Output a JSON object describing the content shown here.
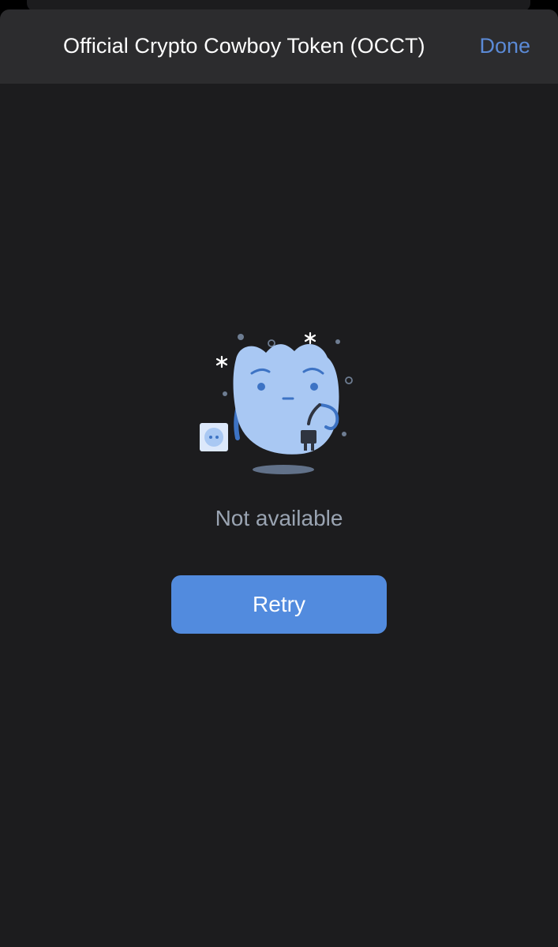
{
  "header": {
    "title": "Official Crypto Cowboy Token (OCCT)",
    "done_label": "Done"
  },
  "main": {
    "status_text": "Not available",
    "retry_label": "Retry",
    "illustration_icon": "unplugged-ghost-icon"
  },
  "colors": {
    "background": "#1c1c1e",
    "nav_background": "#2c2c2e",
    "accent": "#528bde",
    "link": "#5b8ad6",
    "status_text": "#9aa4b2",
    "illustration_body": "#a9c8f3"
  }
}
